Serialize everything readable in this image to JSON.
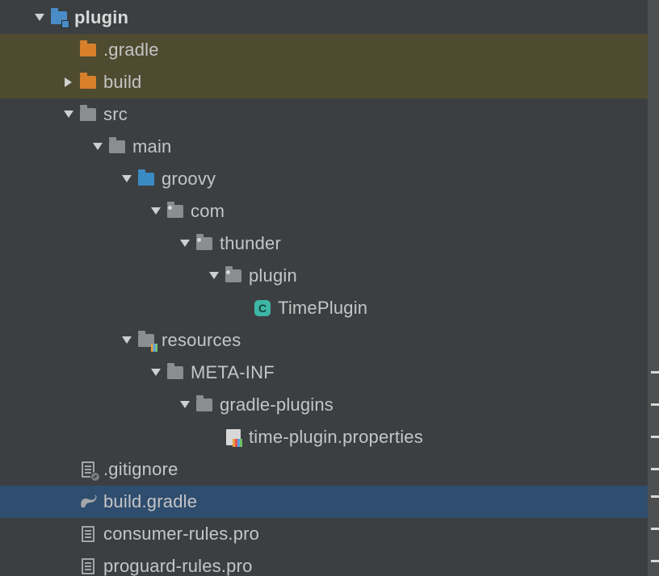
{
  "tree": {
    "plugin": {
      "label": "plugin"
    },
    "gradleDir": {
      "label": ".gradle"
    },
    "build": {
      "label": "build"
    },
    "src": {
      "label": "src"
    },
    "main": {
      "label": "main"
    },
    "groovy": {
      "label": "groovy"
    },
    "com": {
      "label": "com"
    },
    "thunder": {
      "label": "thunder"
    },
    "pluginPkg": {
      "label": "plugin"
    },
    "timePlugin": {
      "label": "TimePlugin",
      "badge": "C"
    },
    "resources": {
      "label": "resources"
    },
    "metaInf": {
      "label": "META-INF"
    },
    "gradlePlugins": {
      "label": "gradle-plugins"
    },
    "timePluginProps": {
      "label": "time-plugin.properties"
    },
    "gitignore": {
      "label": ".gitignore"
    },
    "buildGradle": {
      "label": "build.gradle"
    },
    "consumerRules": {
      "label": "consumer-rules.pro"
    },
    "proguardRules": {
      "label": "proguard-rules.pro"
    }
  },
  "colors": {
    "highlightBuild": "#4e4b30",
    "highlightSelected": "#2f4d6f",
    "folderBlue": "#4a8cc7",
    "folderOrange": "#d87f29",
    "folderGray": "#8b8e90"
  }
}
